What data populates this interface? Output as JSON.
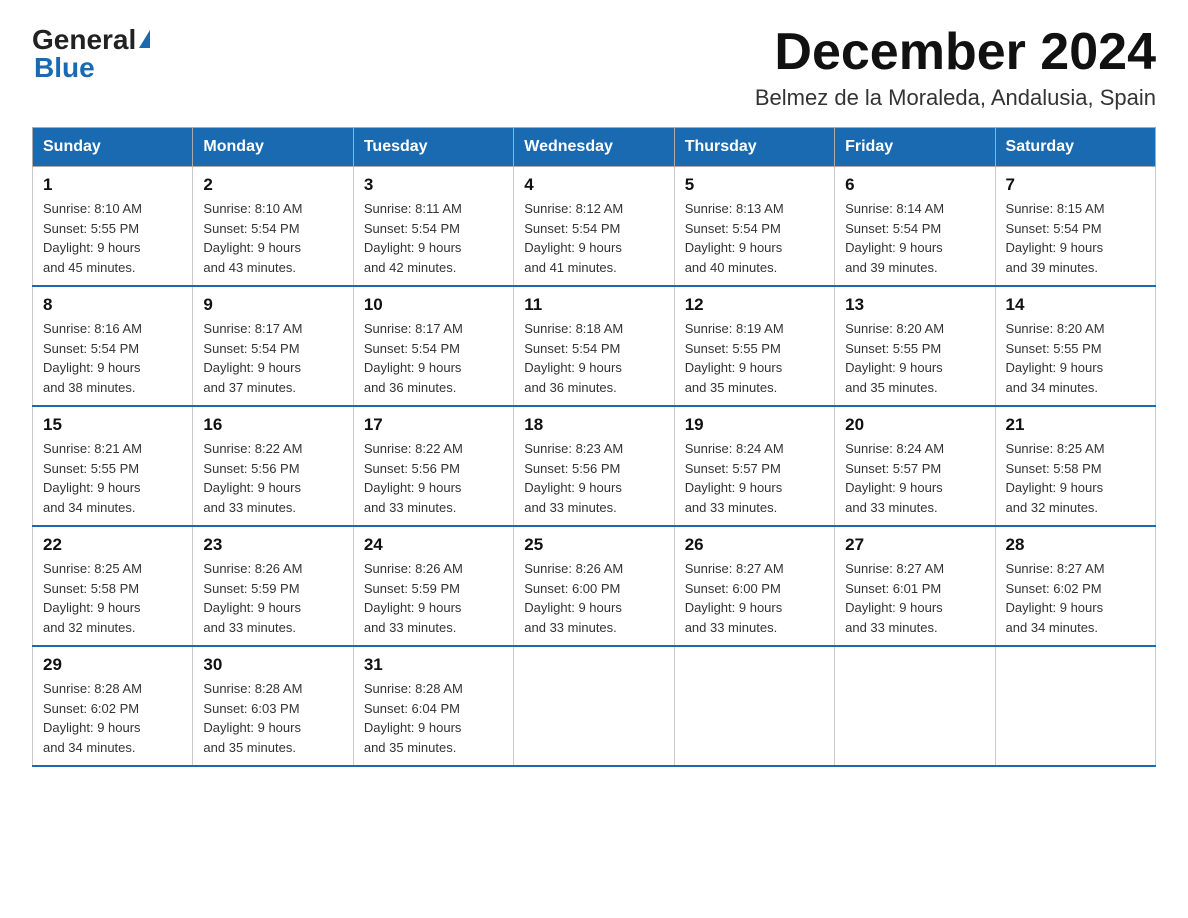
{
  "header": {
    "logo_general": "General",
    "logo_blue": "Blue",
    "title": "December 2024",
    "subtitle": "Belmez de la Moraleda, Andalusia, Spain"
  },
  "days_of_week": [
    "Sunday",
    "Monday",
    "Tuesday",
    "Wednesday",
    "Thursday",
    "Friday",
    "Saturday"
  ],
  "weeks": [
    [
      {
        "day": "1",
        "sunrise": "8:10 AM",
        "sunset": "5:55 PM",
        "daylight": "9 hours and 45 minutes."
      },
      {
        "day": "2",
        "sunrise": "8:10 AM",
        "sunset": "5:54 PM",
        "daylight": "9 hours and 43 minutes."
      },
      {
        "day": "3",
        "sunrise": "8:11 AM",
        "sunset": "5:54 PM",
        "daylight": "9 hours and 42 minutes."
      },
      {
        "day": "4",
        "sunrise": "8:12 AM",
        "sunset": "5:54 PM",
        "daylight": "9 hours and 41 minutes."
      },
      {
        "day": "5",
        "sunrise": "8:13 AM",
        "sunset": "5:54 PM",
        "daylight": "9 hours and 40 minutes."
      },
      {
        "day": "6",
        "sunrise": "8:14 AM",
        "sunset": "5:54 PM",
        "daylight": "9 hours and 39 minutes."
      },
      {
        "day": "7",
        "sunrise": "8:15 AM",
        "sunset": "5:54 PM",
        "daylight": "9 hours and 39 minutes."
      }
    ],
    [
      {
        "day": "8",
        "sunrise": "8:16 AM",
        "sunset": "5:54 PM",
        "daylight": "9 hours and 38 minutes."
      },
      {
        "day": "9",
        "sunrise": "8:17 AM",
        "sunset": "5:54 PM",
        "daylight": "9 hours and 37 minutes."
      },
      {
        "day": "10",
        "sunrise": "8:17 AM",
        "sunset": "5:54 PM",
        "daylight": "9 hours and 36 minutes."
      },
      {
        "day": "11",
        "sunrise": "8:18 AM",
        "sunset": "5:54 PM",
        "daylight": "9 hours and 36 minutes."
      },
      {
        "day": "12",
        "sunrise": "8:19 AM",
        "sunset": "5:55 PM",
        "daylight": "9 hours and 35 minutes."
      },
      {
        "day": "13",
        "sunrise": "8:20 AM",
        "sunset": "5:55 PM",
        "daylight": "9 hours and 35 minutes."
      },
      {
        "day": "14",
        "sunrise": "8:20 AM",
        "sunset": "5:55 PM",
        "daylight": "9 hours and 34 minutes."
      }
    ],
    [
      {
        "day": "15",
        "sunrise": "8:21 AM",
        "sunset": "5:55 PM",
        "daylight": "9 hours and 34 minutes."
      },
      {
        "day": "16",
        "sunrise": "8:22 AM",
        "sunset": "5:56 PM",
        "daylight": "9 hours and 33 minutes."
      },
      {
        "day": "17",
        "sunrise": "8:22 AM",
        "sunset": "5:56 PM",
        "daylight": "9 hours and 33 minutes."
      },
      {
        "day": "18",
        "sunrise": "8:23 AM",
        "sunset": "5:56 PM",
        "daylight": "9 hours and 33 minutes."
      },
      {
        "day": "19",
        "sunrise": "8:24 AM",
        "sunset": "5:57 PM",
        "daylight": "9 hours and 33 minutes."
      },
      {
        "day": "20",
        "sunrise": "8:24 AM",
        "sunset": "5:57 PM",
        "daylight": "9 hours and 33 minutes."
      },
      {
        "day": "21",
        "sunrise": "8:25 AM",
        "sunset": "5:58 PM",
        "daylight": "9 hours and 32 minutes."
      }
    ],
    [
      {
        "day": "22",
        "sunrise": "8:25 AM",
        "sunset": "5:58 PM",
        "daylight": "9 hours and 32 minutes."
      },
      {
        "day": "23",
        "sunrise": "8:26 AM",
        "sunset": "5:59 PM",
        "daylight": "9 hours and 33 minutes."
      },
      {
        "day": "24",
        "sunrise": "8:26 AM",
        "sunset": "5:59 PM",
        "daylight": "9 hours and 33 minutes."
      },
      {
        "day": "25",
        "sunrise": "8:26 AM",
        "sunset": "6:00 PM",
        "daylight": "9 hours and 33 minutes."
      },
      {
        "day": "26",
        "sunrise": "8:27 AM",
        "sunset": "6:00 PM",
        "daylight": "9 hours and 33 minutes."
      },
      {
        "day": "27",
        "sunrise": "8:27 AM",
        "sunset": "6:01 PM",
        "daylight": "9 hours and 33 minutes."
      },
      {
        "day": "28",
        "sunrise": "8:27 AM",
        "sunset": "6:02 PM",
        "daylight": "9 hours and 34 minutes."
      }
    ],
    [
      {
        "day": "29",
        "sunrise": "8:28 AM",
        "sunset": "6:02 PM",
        "daylight": "9 hours and 34 minutes."
      },
      {
        "day": "30",
        "sunrise": "8:28 AM",
        "sunset": "6:03 PM",
        "daylight": "9 hours and 35 minutes."
      },
      {
        "day": "31",
        "sunrise": "8:28 AM",
        "sunset": "6:04 PM",
        "daylight": "9 hours and 35 minutes."
      },
      null,
      null,
      null,
      null
    ]
  ],
  "labels": {
    "sunrise": "Sunrise:",
    "sunset": "Sunset:",
    "daylight": "Daylight:"
  }
}
